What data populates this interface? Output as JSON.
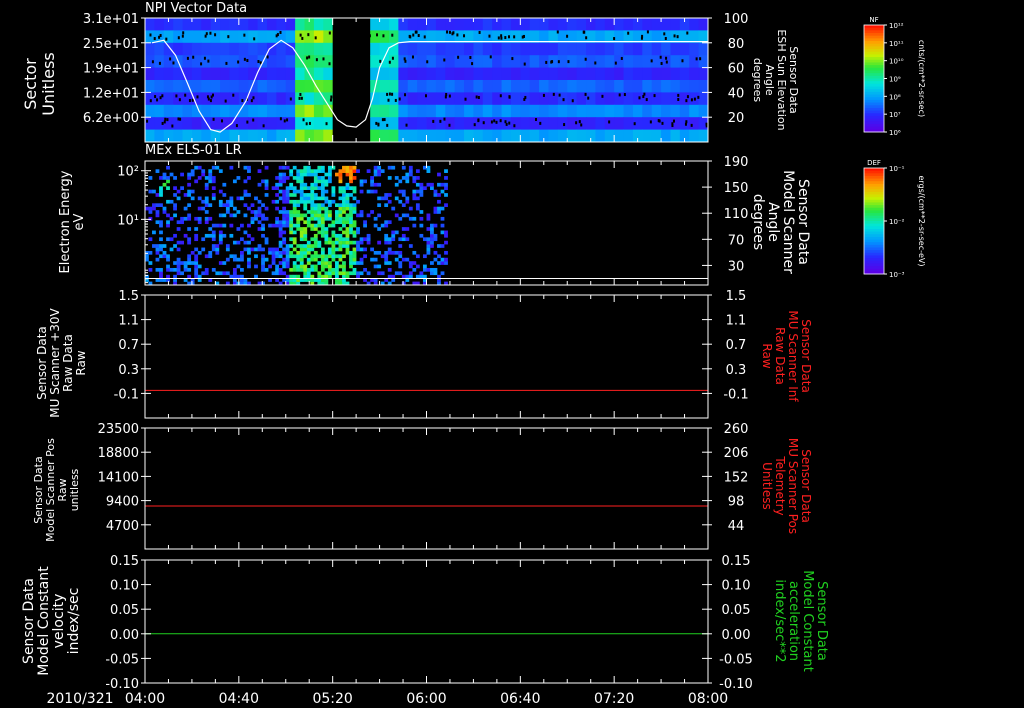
{
  "colors": {
    "spectrogram_low": "#4a10d8",
    "spectrogram_high": "#ff2000",
    "white_line": "#ffffff",
    "red_line": "#ff2020",
    "green_line": "#20d020",
    "axis": "#ffffff"
  },
  "panels": [
    {
      "title": "NPI Vector Data",
      "left_label": "Sector\nUnitless",
      "right_label": "Sensor Data\nESH Sun Elevation\nAngle\ndegrees",
      "right_label_color": "#ffffff",
      "colorbar_title": "NF",
      "colorbar_unit": "cnts/(cm**2-sr-sec)",
      "colorbar_ticks": [
        "10¹²",
        "10¹¹",
        "10¹⁰",
        "10⁹",
        "10⁸",
        "10⁷",
        "10⁶"
      ]
    },
    {
      "title": "MEx ELS-01 LR",
      "left_label": "Electron Energy\neV",
      "right_label": "Sensor Data\nModel Scanner\nAngle\ndegrees",
      "right_label_color": "#ffffff",
      "colorbar_title": "DEF",
      "colorbar_unit": "ergs/(cm**2-sr-sec-eV)",
      "colorbar_ticks": [
        "10⁻¹",
        "10⁻²",
        "10⁻³"
      ]
    },
    {
      "title": "",
      "left_label": "Sensor Data\nMU Scanner +30V\nRaw Data\nRaw",
      "right_label": "Sensor Data\nMU Scanner Inf\nRaw Data\nRaw",
      "right_label_color": "#ff2020"
    },
    {
      "title": "",
      "left_label": "Sensor Data\nModel Scanner Pos\nRaw\nunitless",
      "right_label": "Sensor Data\nMU Scanner Pos\nTelemetry\nUnitless",
      "right_label_color": "#ff2020"
    },
    {
      "title": "",
      "left_label": "Sensor Data\nModel Constant\nvelocity\nindex/sec",
      "right_label": "Sensor Data\nModel Constant\nacceleration\nindex/sec**2",
      "right_label_color": "#20d020"
    }
  ],
  "chart_data": [
    {
      "type": "heatmap",
      "title": "NPI Vector Data",
      "ylabel": "Sector Unitless",
      "ytick_labels": [
        "3.1e+01",
        "2.5e+01",
        "1.9e+01",
        "1.2e+01",
        "6.2e+00"
      ],
      "ylim": [
        0,
        31
      ],
      "y2label": "Sensor Data ESH Sun Elevation Angle degrees",
      "y2ticks": [
        20,
        40,
        60,
        80,
        100
      ],
      "y2lim": [
        0,
        100
      ],
      "data_gap_minutes": [
        320,
        335
      ],
      "overlay_line": {
        "color": "#ffffff",
        "x_minutes": [
          243,
          248,
          253,
          258,
          263,
          268,
          272,
          277,
          283,
          288,
          293,
          298,
          303,
          308,
          313,
          318,
          322,
          326,
          330,
          334,
          337,
          340,
          344,
          348,
          353,
          360,
          380,
          420,
          460,
          480
        ],
        "y": [
          80,
          82,
          70,
          48,
          25,
          10,
          8,
          15,
          33,
          56,
          75,
          82,
          76,
          62,
          45,
          30,
          18,
          13,
          12,
          18,
          35,
          60,
          76,
          80,
          81,
          81,
          81,
          81,
          81,
          81
        ]
      }
    },
    {
      "type": "heatmap",
      "title": "MEx ELS-01 LR",
      "ylabel": "Electron Energy eV",
      "yscale": "log",
      "ytick_labels": [
        "10²",
        "10¹"
      ],
      "ylim_exp": [
        -0.35,
        2.2
      ],
      "y2label": "Sensor Data Model Scanner Angle degrees",
      "y2ticks": [
        30,
        70,
        110,
        150,
        190
      ],
      "y2lim": [
        0,
        190
      ],
      "data_end_minutes": 368,
      "overlay_line": {
        "color": "#ffffff",
        "value": 10
      }
    },
    {
      "type": "line",
      "ylabel": "Sensor Data MU Scanner +30V Raw Data Raw",
      "yticks": [
        "1.5",
        "1.1",
        "0.7",
        "0.3",
        "-0.1"
      ],
      "ylim": [
        -0.5,
        1.5
      ],
      "y2label": "Sensor Data MU Scanner Inf Raw Data Raw",
      "series": [
        {
          "color": "#ff2020",
          "x_minutes": [
            240,
            480
          ],
          "values": [
            -0.05,
            -0.05
          ]
        }
      ]
    },
    {
      "type": "line",
      "ylabel": "Sensor Data Model Scanner Pos Raw unitless",
      "yticks": [
        "23500",
        "18800",
        "14100",
        "9400",
        "4700"
      ],
      "ylim": [
        0,
        23500
      ],
      "y2label": "Sensor Data MU Scanner Pos Telemetry Unitless",
      "y2ticks": [
        "260",
        "206",
        "152",
        "98",
        "44"
      ],
      "series": [
        {
          "color": "#ff2020",
          "x_minutes": [
            240,
            480
          ],
          "values": [
            8350,
            8350
          ]
        }
      ]
    },
    {
      "type": "line",
      "ylabel": "Sensor Data Model Constant velocity index/sec",
      "yticks": [
        "0.15",
        "0.10",
        "0.05",
        "0.00",
        "-0.05",
        "-0.10"
      ],
      "ylim": [
        -0.1,
        0.15
      ],
      "y2label": "Sensor Data Model Constant acceleration index/sec**2",
      "series": [
        {
          "color": "#20d020",
          "x_minutes": [
            240,
            480
          ],
          "values": [
            0.0,
            0.0
          ]
        }
      ]
    }
  ],
  "time_axis": {
    "date_label": "2010/321",
    "xlim_minutes": [
      240,
      480
    ],
    "tick_minutes": [
      240,
      280,
      320,
      360,
      400,
      440,
      480
    ],
    "tick_labels": [
      "04:00",
      "04:40",
      "05:20",
      "06:00",
      "06:40",
      "07:20",
      "08:00"
    ]
  }
}
